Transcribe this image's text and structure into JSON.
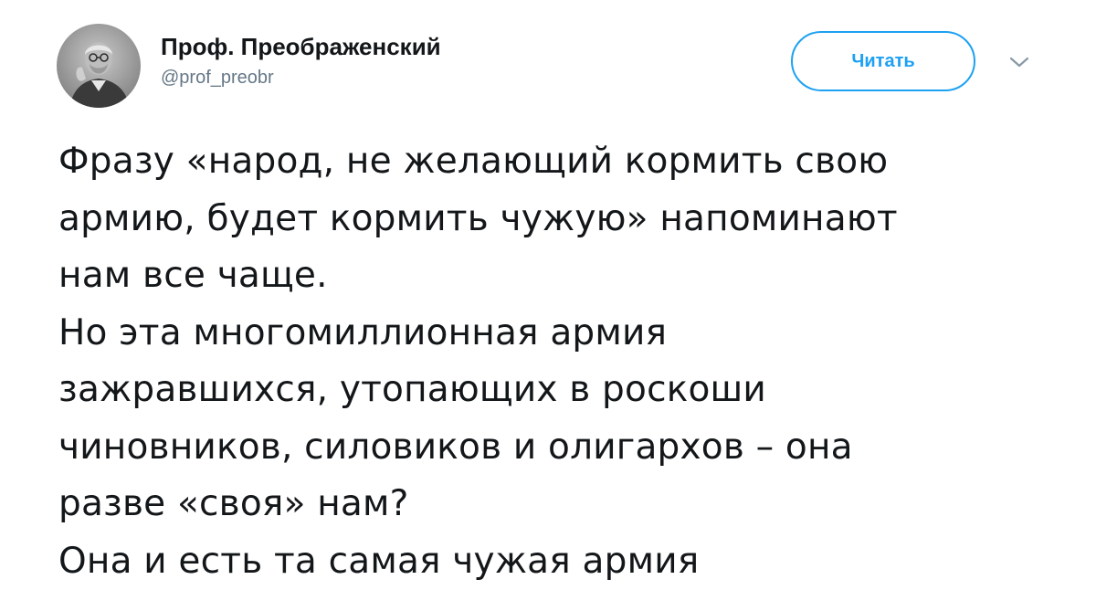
{
  "author": {
    "display_name": "Проф. Преображенский",
    "handle": "@prof_preobr",
    "avatar_icon": "profile-photo-grayscale"
  },
  "actions": {
    "follow_label": "Читать",
    "menu_icon": "chevron-down-icon"
  },
  "tweet": {
    "lines": [
      "Фразу «народ, не желающий кормить свою",
      "армию, будет кормить чужую» напоминают",
      "нам все чаще.",
      "Но эта многомиллионная армия",
      "зажравшихся, утопающих в роскоши",
      "чиновников, силовиков и олигархов – она",
      "разве «своя» нам?",
      "Она и есть та самая чужая армия"
    ]
  },
  "colors": {
    "accent": "#1da1f2",
    "text": "#14171a",
    "secondary": "#657786"
  }
}
